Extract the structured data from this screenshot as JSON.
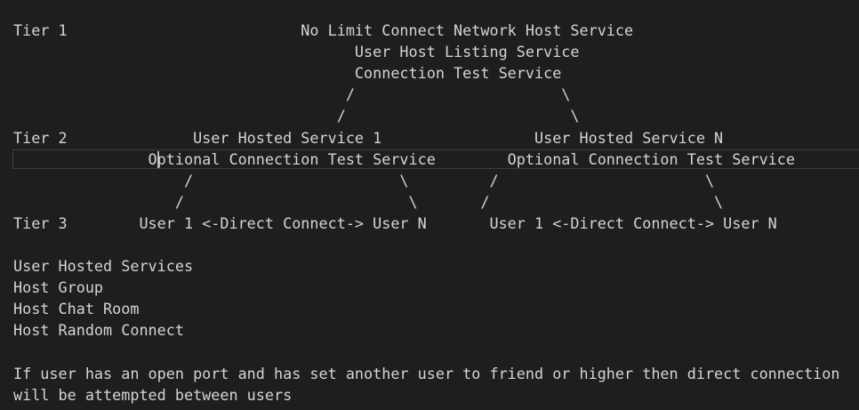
{
  "editor": {
    "lines": [
      "Tier 1                          No Limit Connect Network Host Service",
      "                                      User Host Listing Service",
      "                                      Connection Test Service",
      "                                     /                       \\",
      "                                    /                         \\",
      "Tier 2              User Hosted Service 1                 User Hosted Service N",
      "               Optional Connection Test Service        Optional Connection Test Service",
      "                   /                       \\         /                       \\",
      "                  /                         \\       /                         \\",
      "Tier 3        User 1 <-Direct Connect-> User N       User 1 <-Direct Connect-> User N",
      "",
      "User Hosted Services",
      "Host Group",
      "Host Chat Room",
      "Host Random Connect",
      "",
      "If user has an open port and has set another user to friend or higher then direct connection",
      "will be attempted between users"
    ]
  }
}
